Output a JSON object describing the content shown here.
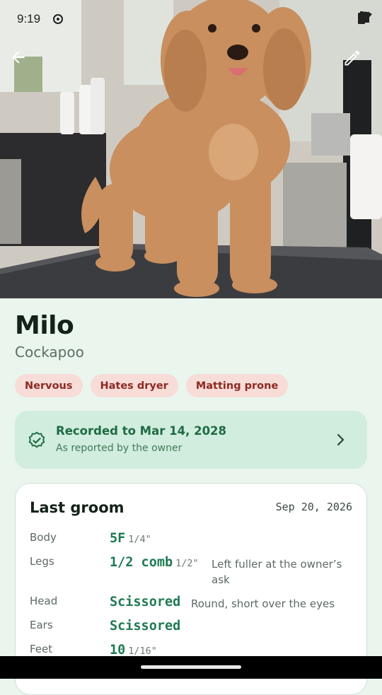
{
  "status_bar": {
    "time": "9:19"
  },
  "pet": {
    "name": "Milo",
    "breed": "Cockapoo",
    "tags": [
      "Nervous",
      "Hates dryer",
      "Matting prone"
    ]
  },
  "recorded": {
    "title": "Recorded to Mar 14, 2028",
    "subtitle": "As reported by the owner"
  },
  "last_groom": {
    "title": "Last groom",
    "date": "Sep 20, 2026",
    "rows": [
      {
        "label": "Body",
        "value": "5F",
        "unit": "1/4\"",
        "note": ""
      },
      {
        "label": "Legs",
        "value": "1/2 comb",
        "unit": "1/2\"",
        "note": "Left fuller at the owner’s ask"
      },
      {
        "label": "Head",
        "value": "Scissored",
        "unit": "",
        "note": "Round, short over the eyes"
      },
      {
        "label": "Ears",
        "value": "Scissored",
        "unit": "",
        "note": ""
      },
      {
        "label": "Feet",
        "value": "10",
        "unit": "1/16\"",
        "note": ""
      }
    ]
  },
  "icons": {
    "back": "arrow-left-icon",
    "edit": "pencil-icon",
    "verified": "verified-badge-icon",
    "chevron": "chevron-right-icon"
  },
  "colors": {
    "accent": "#1e7a52",
    "chip_bg": "#f7dcd7",
    "chip_text": "#8e2a22",
    "recorded_bg": "#d1eddd"
  }
}
